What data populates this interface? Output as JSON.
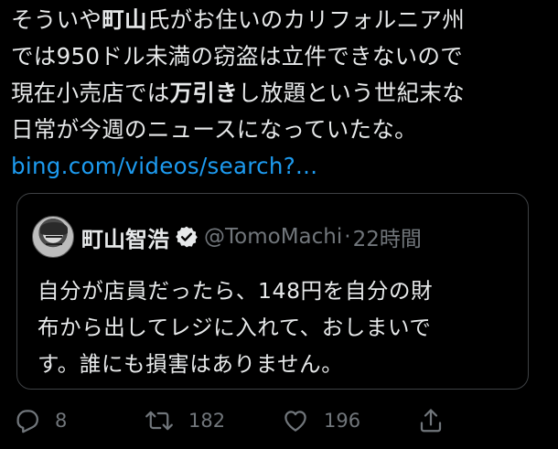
{
  "tweet": {
    "lines": [
      {
        "pre": "そういや",
        "bold": "町山",
        "post": "氏がお住いのカリフォルニア州"
      },
      {
        "pre": "では950ドル未満の窃盗は立件できないので",
        "bold": "",
        "post": ""
      },
      {
        "pre": "現在小売店では",
        "bold": "万引き",
        "post": "し放題という世紀末な"
      },
      {
        "pre": "日常が今週のニュースになっていたな。",
        "bold": "",
        "post": ""
      }
    ],
    "link": "bing.com/videos/search?..."
  },
  "quote": {
    "name": "町山智浩",
    "handle": "@TomoMachi",
    "separator": "·",
    "time": "22時間",
    "lines": [
      "自分が店員だったら、148円を自分の財",
      "布から出してレジに入れて、おしまいで",
      "す。誰にも損害はありません。"
    ]
  },
  "actions": {
    "reply_count": "8",
    "retweet_count": "182",
    "like_count": "196"
  },
  "icons": {
    "reply": "reply-icon",
    "retweet": "retweet-icon",
    "like": "heart-icon",
    "share": "share-icon",
    "verified": "verified-badge-icon"
  },
  "colors": {
    "background": "#000000",
    "text": "#e7e9ea",
    "muted": "#71767b",
    "link": "#1d9bf0",
    "border": "#3e4144"
  }
}
